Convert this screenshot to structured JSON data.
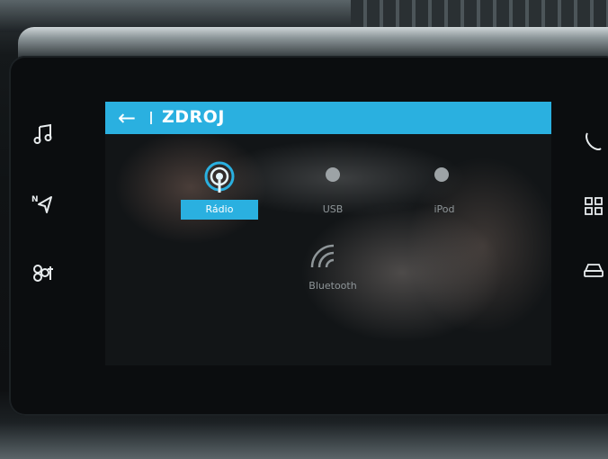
{
  "header": {
    "back_icon": "arrow-left-icon",
    "title": "ZDROJ"
  },
  "sources": [
    {
      "label": "Rádio",
      "icon": "radio-antenna-icon",
      "selected": true
    },
    {
      "label": "USB",
      "icon": "usb-icon",
      "selected": false
    },
    {
      "label": "iPod",
      "icon": "ipod-icon",
      "selected": false
    },
    {
      "label": "Bluetooth",
      "icon": "bluetooth-wireless-icon",
      "selected": false
    }
  ],
  "left_buttons": [
    {
      "icon": "music-note-icon"
    },
    {
      "icon": "navigation-icon"
    },
    {
      "icon": "settings-icon"
    }
  ],
  "right_buttons": [
    {
      "icon": "phone-icon"
    },
    {
      "icon": "apps-grid-icon"
    },
    {
      "icon": "car-icon"
    }
  ],
  "colors": {
    "accent": "#2ab0e0",
    "screen_bg": "#121517",
    "label_inactive": "#8f9699"
  }
}
